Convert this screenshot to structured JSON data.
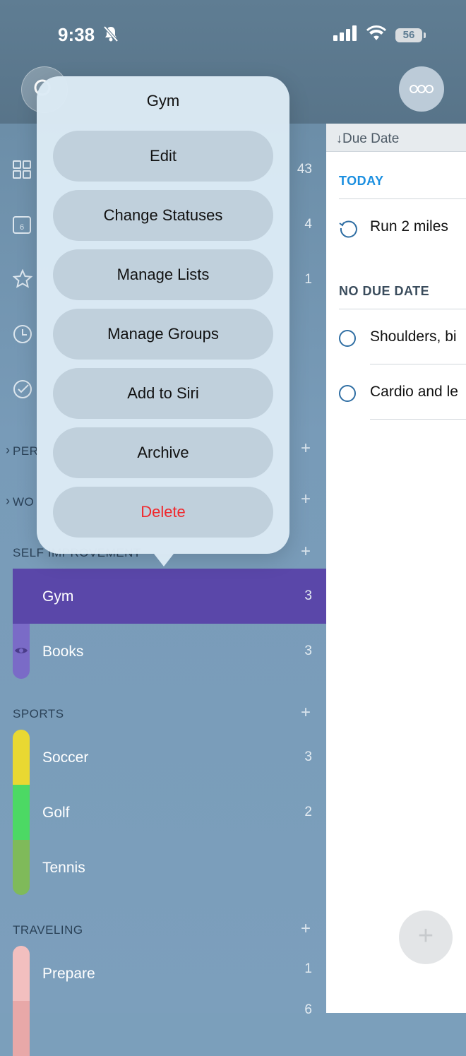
{
  "status_bar": {
    "time": "9:38",
    "battery": "56"
  },
  "sort": {
    "label": "Due Date"
  },
  "smart_lists": [
    {
      "icon": "grid-icon",
      "count": "43"
    },
    {
      "icon": "calendar-icon",
      "count": "4",
      "badge": "6"
    },
    {
      "icon": "star-icon",
      "count": "1"
    },
    {
      "icon": "clock-icon",
      "count": ""
    },
    {
      "icon": "check-circle-icon",
      "count": ""
    }
  ],
  "groups": {
    "personal": {
      "label": "PER"
    },
    "work": {
      "label": "WO"
    },
    "self_improvement": {
      "label": "SELF IMPROVEMENT",
      "lists": [
        {
          "name": "Gym",
          "count": "3",
          "color": "#5a47a9"
        },
        {
          "name": "Books",
          "count": "3",
          "color": "#7a6bc7"
        }
      ]
    },
    "sports": {
      "label": "SPORTS",
      "lists": [
        {
          "name": "Soccer",
          "count": "3",
          "color": "#e9d832"
        },
        {
          "name": "Golf",
          "count": "2",
          "color": "#4cd964"
        },
        {
          "name": "Tennis",
          "count": "",
          "color": "#7fba5a"
        }
      ]
    },
    "traveling": {
      "label": "TRAVELING",
      "lists": [
        {
          "name": "Prepare",
          "count": "1",
          "color": "#f2bfbf"
        },
        {
          "name": "",
          "count": "6",
          "color": "#e8a8a8"
        }
      ]
    }
  },
  "detail": {
    "today_header": "TODAY",
    "no_due_header": "NO DUE DATE",
    "today_tasks": [
      "Run 2 miles"
    ],
    "no_due_tasks": [
      "Shoulders, bi",
      "Cardio and le"
    ]
  },
  "popover": {
    "title": "Gym",
    "items": [
      "Edit",
      "Change Statuses",
      "Manage Lists",
      "Manage Groups",
      "Add to Siri",
      "Archive",
      "Delete"
    ]
  },
  "colors": {
    "accent_blue": "#1b8fe0",
    "delete_red": "#f0282d",
    "selected_row": "#5a47a9"
  }
}
